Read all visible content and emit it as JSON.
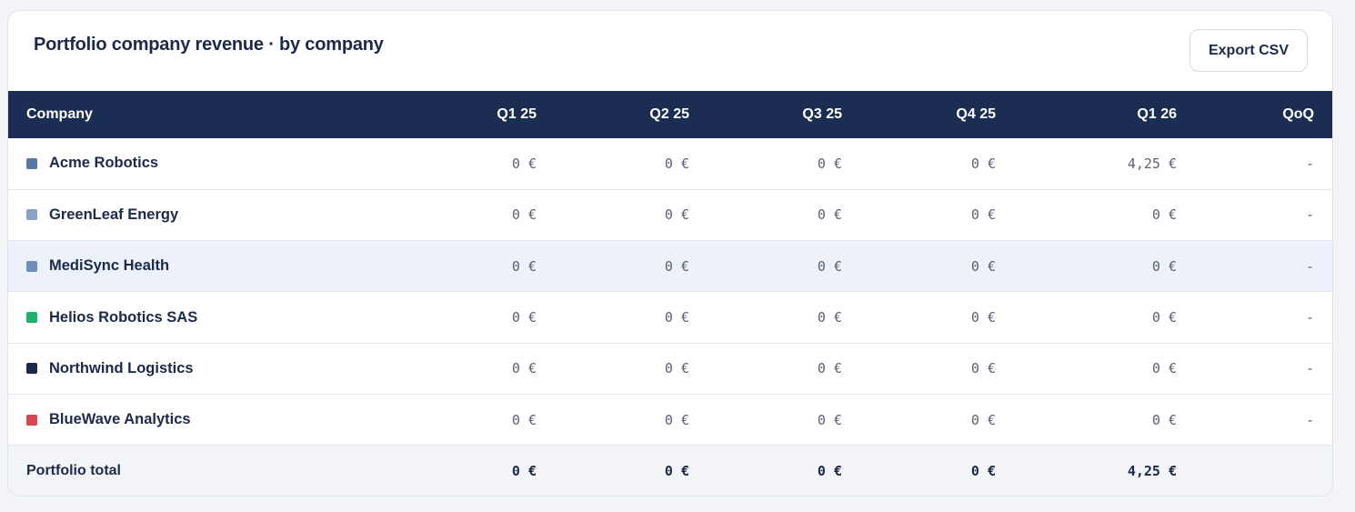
{
  "title": "Portfolio company revenue · by company",
  "export_label": "Export CSV",
  "columns": {
    "company": "Company",
    "q1": "Q1 25",
    "q2": "Q2 25",
    "q3": "Q3 25",
    "q4": "Q4 25",
    "q5": "Q1 26",
    "qoq": "QoQ"
  },
  "rows": [
    {
      "name": "Acme Robotics",
      "color": "#5878a8",
      "q1": "0 €",
      "q2": "0 €",
      "q3": "0 €",
      "q4": "0 €",
      "q5": "4,25 €",
      "qoq": "-"
    },
    {
      "name": "GreenLeaf Energy",
      "color": "#8aa2c8",
      "q1": "0 €",
      "q2": "0 €",
      "q3": "0 €",
      "q4": "0 €",
      "q5": "0 €",
      "qoq": "-"
    },
    {
      "name": "MediSync Health",
      "color": "#6e8cbc",
      "q1": "0 €",
      "q2": "0 €",
      "q3": "0 €",
      "q4": "0 €",
      "q5": "0 €",
      "qoq": "-"
    },
    {
      "name": "Helios Robotics SAS",
      "color": "#1db36a",
      "q1": "0 €",
      "q2": "0 €",
      "q3": "0 €",
      "q4": "0 €",
      "q5": "0 €",
      "qoq": "-"
    },
    {
      "name": "Northwind Logistics",
      "color": "#1b2a4a",
      "q1": "0 €",
      "q2": "0 €",
      "q3": "0 €",
      "q4": "0 €",
      "q5": "0 €",
      "qoq": "-"
    },
    {
      "name": "BlueWave Analytics",
      "color": "#d9484f",
      "q1": "0 €",
      "q2": "0 €",
      "q3": "0 €",
      "q4": "0 €",
      "q5": "0 €",
      "qoq": "-"
    }
  ],
  "total": {
    "label": "Portfolio total",
    "q1": "0 €",
    "q2": "0 €",
    "q3": "0 €",
    "q4": "0 €",
    "q5": "4,25 €"
  }
}
